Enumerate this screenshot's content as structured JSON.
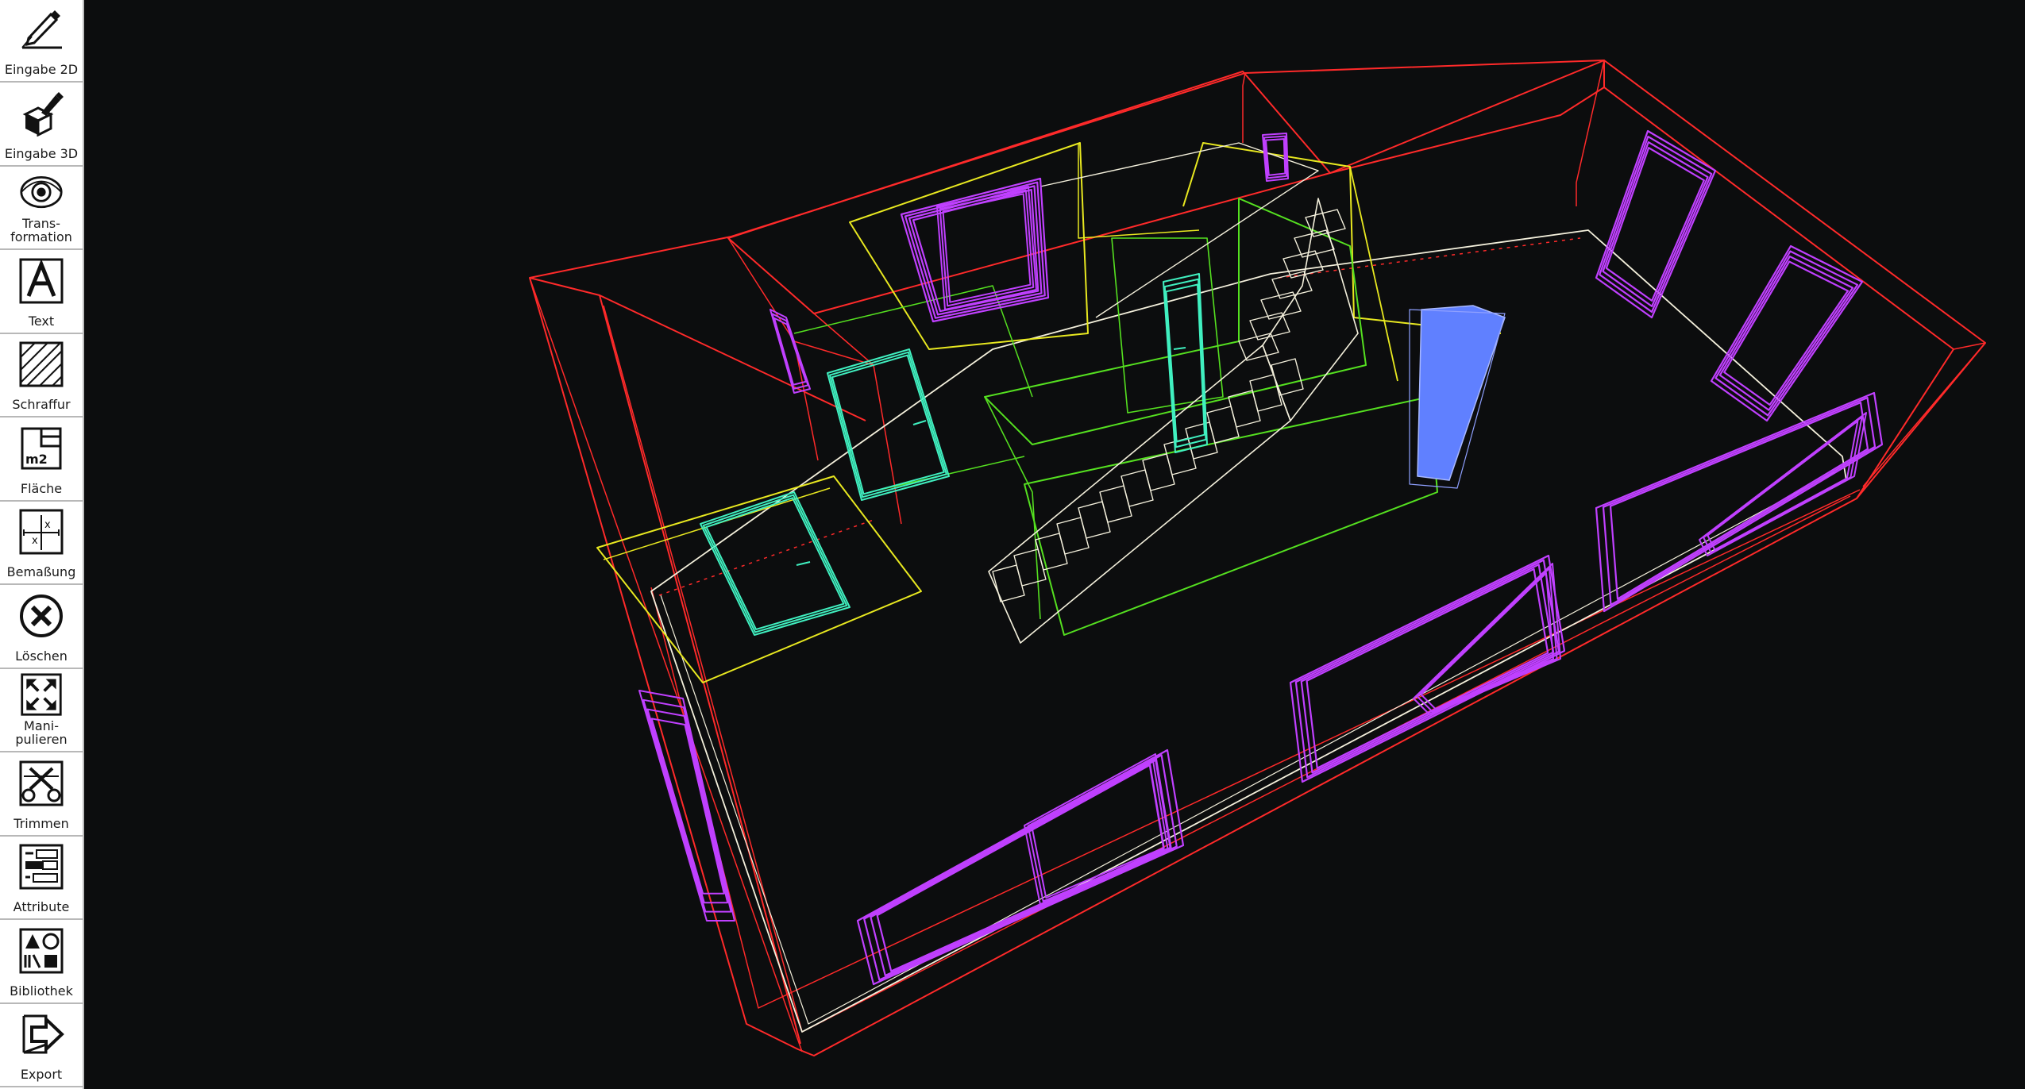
{
  "toolbar": {
    "tools": [
      {
        "id": "eingabe-2d",
        "label": "Eingabe 2D",
        "icon": "pencil-2d-icon"
      },
      {
        "id": "eingabe-3d",
        "label": "Eingabe 3D",
        "icon": "pencil-3d-cube-icon"
      },
      {
        "id": "transformation",
        "label": "Trans-\nformation",
        "icon": "eye-icon"
      },
      {
        "id": "text",
        "label": "Text",
        "icon": "letter-a-icon"
      },
      {
        "id": "schraffur",
        "label": "Schraffur",
        "icon": "hatch-icon"
      },
      {
        "id": "flaeche",
        "label": "Fläche",
        "icon": "area-m2-icon"
      },
      {
        "id": "bemassung",
        "label": "Bemaßung",
        "icon": "dimension-icon"
      },
      {
        "id": "loeschen",
        "label": "Löschen",
        "icon": "delete-x-icon"
      },
      {
        "id": "manipulieren",
        "label": "Mani-\npulieren",
        "icon": "expand-arrows-icon"
      },
      {
        "id": "trimmen",
        "label": "Trimmen",
        "icon": "scissors-icon"
      },
      {
        "id": "attribute",
        "label": "Attribute",
        "icon": "attribute-list-icon"
      },
      {
        "id": "bibliothek",
        "label": "Bibliothek",
        "icon": "library-shapes-icon"
      },
      {
        "id": "export",
        "label": "Export",
        "icon": "export-arrow-icon"
      }
    ]
  },
  "viewport": {
    "icon_names": [
      "wireframe-3d-floorplan"
    ],
    "colors": {
      "background": "#0c0d0e",
      "walls": "#ff2a2a",
      "windows": "#c040ff",
      "doors": "#40f0c0",
      "openings": "#e8e820",
      "stair_zone": "#55e020",
      "stairs": "#f4f0dc",
      "radiator": "#6080ff"
    }
  }
}
